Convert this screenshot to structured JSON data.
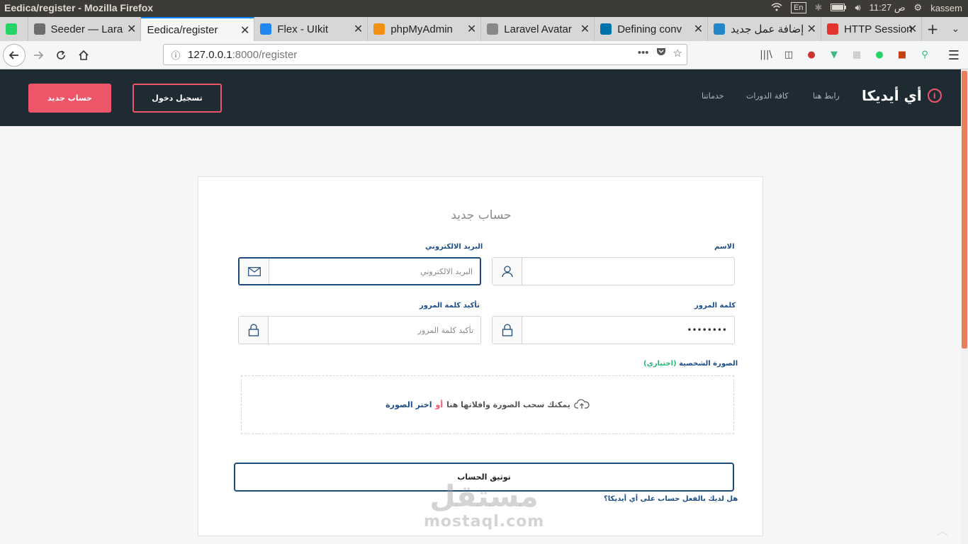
{
  "os": {
    "window_title": "Eedica/register - Mozilla Firefox",
    "lang": "En",
    "time": "11:27 ص",
    "user": "kassem"
  },
  "tabs": [
    {
      "label": "",
      "color": "#25d366"
    },
    {
      "label": "Seeder — Lara",
      "color": "#6d6d6d"
    },
    {
      "label": "Eedica/register",
      "color": "",
      "active": true
    },
    {
      "label": "Flex - UIkit",
      "color": "#1e87f0"
    },
    {
      "label": "phpMyAdmin",
      "color": "#f29111"
    },
    {
      "label": "Laravel Avatar",
      "color": "#888888"
    },
    {
      "label": "Defining conv",
      "color": "#0073aa"
    },
    {
      "label": "إضافة عمل جديد",
      "color": "#2386c8"
    },
    {
      "label": "HTTP Session",
      "color": "#e3342f"
    }
  ],
  "browser": {
    "url_host": "127.0.0.1",
    "url_path": ":8000/register"
  },
  "header": {
    "brand": "أي أيديكا",
    "nav": {
      "contact": "رابط هنا",
      "courses": "كافة الدورات",
      "services": "خدماتنا"
    },
    "login": "تسجيل دخول",
    "signup": "حساب جديد"
  },
  "form": {
    "title": "حساب جديد",
    "name_label": "الاسم",
    "name_value": "",
    "email_label": "البريد الالكتروني",
    "email_placeholder": "البريد الالكتروني",
    "password_label": "كلمة المرور",
    "password_value": "••••••••",
    "confirm_label": "تأكيد كلمة المرور",
    "confirm_placeholder": "تأكيد كلمة المرور",
    "avatar_label": "الصورة الشخصية",
    "avatar_optional": "(اختياري)",
    "dropzone_text": "يمكنك سحب الصورة وافلاتها هنا",
    "dropzone_or": "أو",
    "dropzone_link": "اختر الصورة",
    "submit": "توثيق الحساب",
    "have_account": "هل لديك بالفعل حساب على أي أيديكا؟"
  },
  "watermark": {
    "arabic": "مستقل",
    "latin": "mostaql.com"
  },
  "colors": {
    "accent": "#ef5569",
    "primary": "#1e4c7a",
    "header_bg": "#1f2b33",
    "optional": "#2ab673"
  }
}
